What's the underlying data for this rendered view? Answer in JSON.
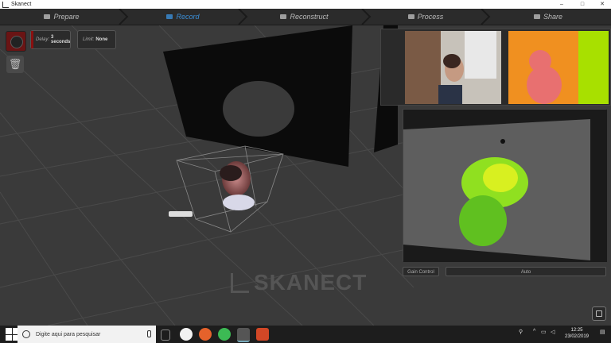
{
  "window": {
    "title": "Skanect",
    "minimize": "–",
    "maximize": "□",
    "close": "✕"
  },
  "tabs": [
    {
      "label": "Prepare"
    },
    {
      "label": "Record"
    },
    {
      "label": "Reconstruct"
    },
    {
      "label": "Process"
    },
    {
      "label": "Share"
    }
  ],
  "active_tab": "Record",
  "controls": {
    "delay_label": "Delay:",
    "delay_value": "3 seconds",
    "limit_label": "Limit:",
    "limit_value": "None"
  },
  "camera": {
    "gain_label": "Gain Control",
    "gain_value": "Auto"
  },
  "brand": "SKANECT",
  "taskbar": {
    "search_placeholder": "Digite aqui para pesquisar",
    "time": "12:25",
    "date": "23/02/2019"
  },
  "colors": {
    "accent": "#3b8fd8",
    "record": "#6a1414",
    "background": "#3a3a3a"
  }
}
